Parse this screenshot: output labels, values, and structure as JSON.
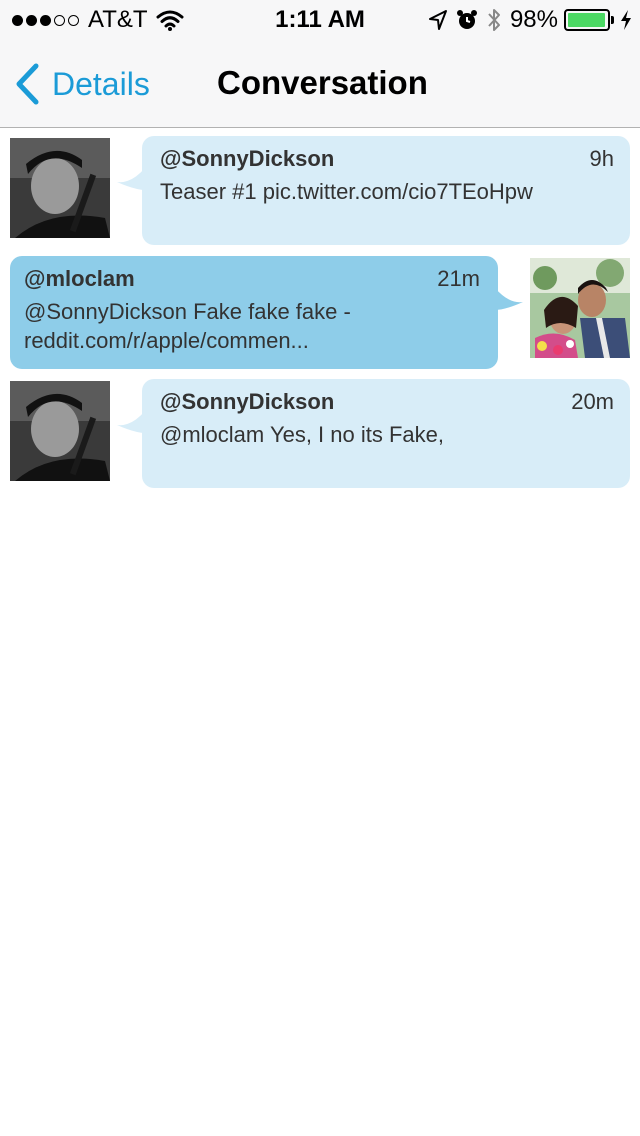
{
  "status_bar": {
    "carrier": "AT&T",
    "time": "1:11 AM",
    "battery_percent": "98%",
    "battery_level": 0.98,
    "icons": [
      "signal-dots-icon",
      "wifi-icon",
      "location-arrow-icon",
      "alarm-clock-icon",
      "bluetooth-icon",
      "battery-icon",
      "charging-bolt-icon"
    ]
  },
  "nav": {
    "back_label": "Details",
    "title": "Conversation"
  },
  "colors": {
    "accent": "#1b9bd7",
    "bubble_incoming": "#d8edf8",
    "bubble_outgoing": "#8ecde9",
    "battery_fill": "#4cd964"
  },
  "messages": [
    {
      "handle": "@SonnyDickson",
      "time": "9h",
      "lines": [
        "Teaser #1 pic.twitter.com/cio7TEoHpw"
      ],
      "side": "left"
    },
    {
      "handle": "@mloclam",
      "time": "21m",
      "lines": [
        "@SonnyDickson Fake fake fake -",
        "reddit.com/r/apple/commen..."
      ],
      "side": "right"
    },
    {
      "handle": "@SonnyDickson",
      "time": "20m",
      "lines": [
        "@mloclam Yes, I no its Fake,"
      ],
      "side": "left"
    }
  ]
}
